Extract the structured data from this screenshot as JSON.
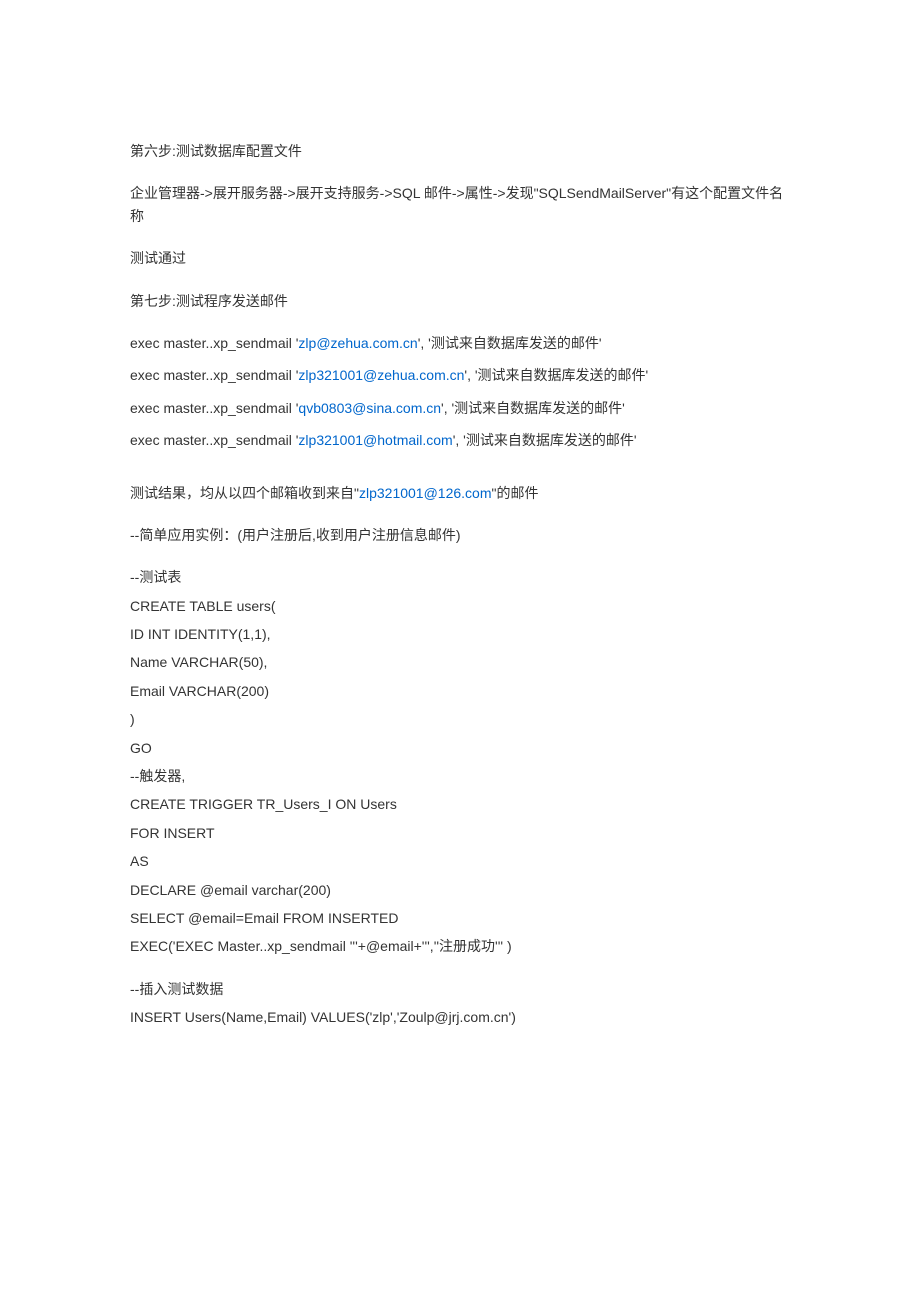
{
  "step6": {
    "heading": "第六步:测试数据库配置文件",
    "path": "企业管理器->展开服务器->展开支持服务->SQL 邮件->属性->发现\"SQLSendMailServer\"有这个配置文件名称",
    "result": "测试通过"
  },
  "step7": {
    "heading": "第七步:测试程序发送邮件",
    "exec_lines": [
      {
        "prefix": "exec master..xp_sendmail '",
        "email": "zlp@zehua.com.cn",
        "suffix": "', '测试来自数据库发送的邮件'"
      },
      {
        "prefix": "exec master..xp_sendmail '",
        "email": "zlp321001@zehua.com.cn",
        "suffix": "', '测试来自数据库发送的邮件'"
      },
      {
        "prefix": "exec master..xp_sendmail '",
        "email": "qvb0803@sina.com.cn",
        "suffix": "', '测试来自数据库发送的邮件'"
      },
      {
        "prefix": "exec master..xp_sendmail '",
        "email": "zlp321001@hotmail.com",
        "suffix": "', '测试来自数据库发送的邮件'"
      }
    ]
  },
  "test_result": {
    "prefix": "测试结果，均从以四个邮箱收到来自\"",
    "email": "zlp321001@126.com",
    "suffix": "\"的邮件"
  },
  "usage_example": "--简单应用实例：(用户注册后,收到用户注册信息邮件)",
  "sql": {
    "comment_test_table": "--测试表",
    "create_table": [
      "CREATE TABLE users(",
      " ID INT IDENTITY(1,1),",
      " Name VARCHAR(50),",
      " Email VARCHAR(200)",
      " )",
      "GO"
    ],
    "comment_trigger": "--触发器,",
    "create_trigger": [
      "CREATE TRIGGER TR_Users_I ON Users",
      "FOR INSERT",
      "AS",
      "DECLARE @email varchar(200)",
      "SELECT @email=Email FROM INSERTED",
      "EXEC('EXEC Master..xp_sendmail '''+@email+''',''注册成功''' )"
    ],
    "comment_insert": "--插入测试数据",
    "insert": "INSERT Users(Name,Email) VALUES('zlp','Zoulp@jrj.com.cn')"
  }
}
